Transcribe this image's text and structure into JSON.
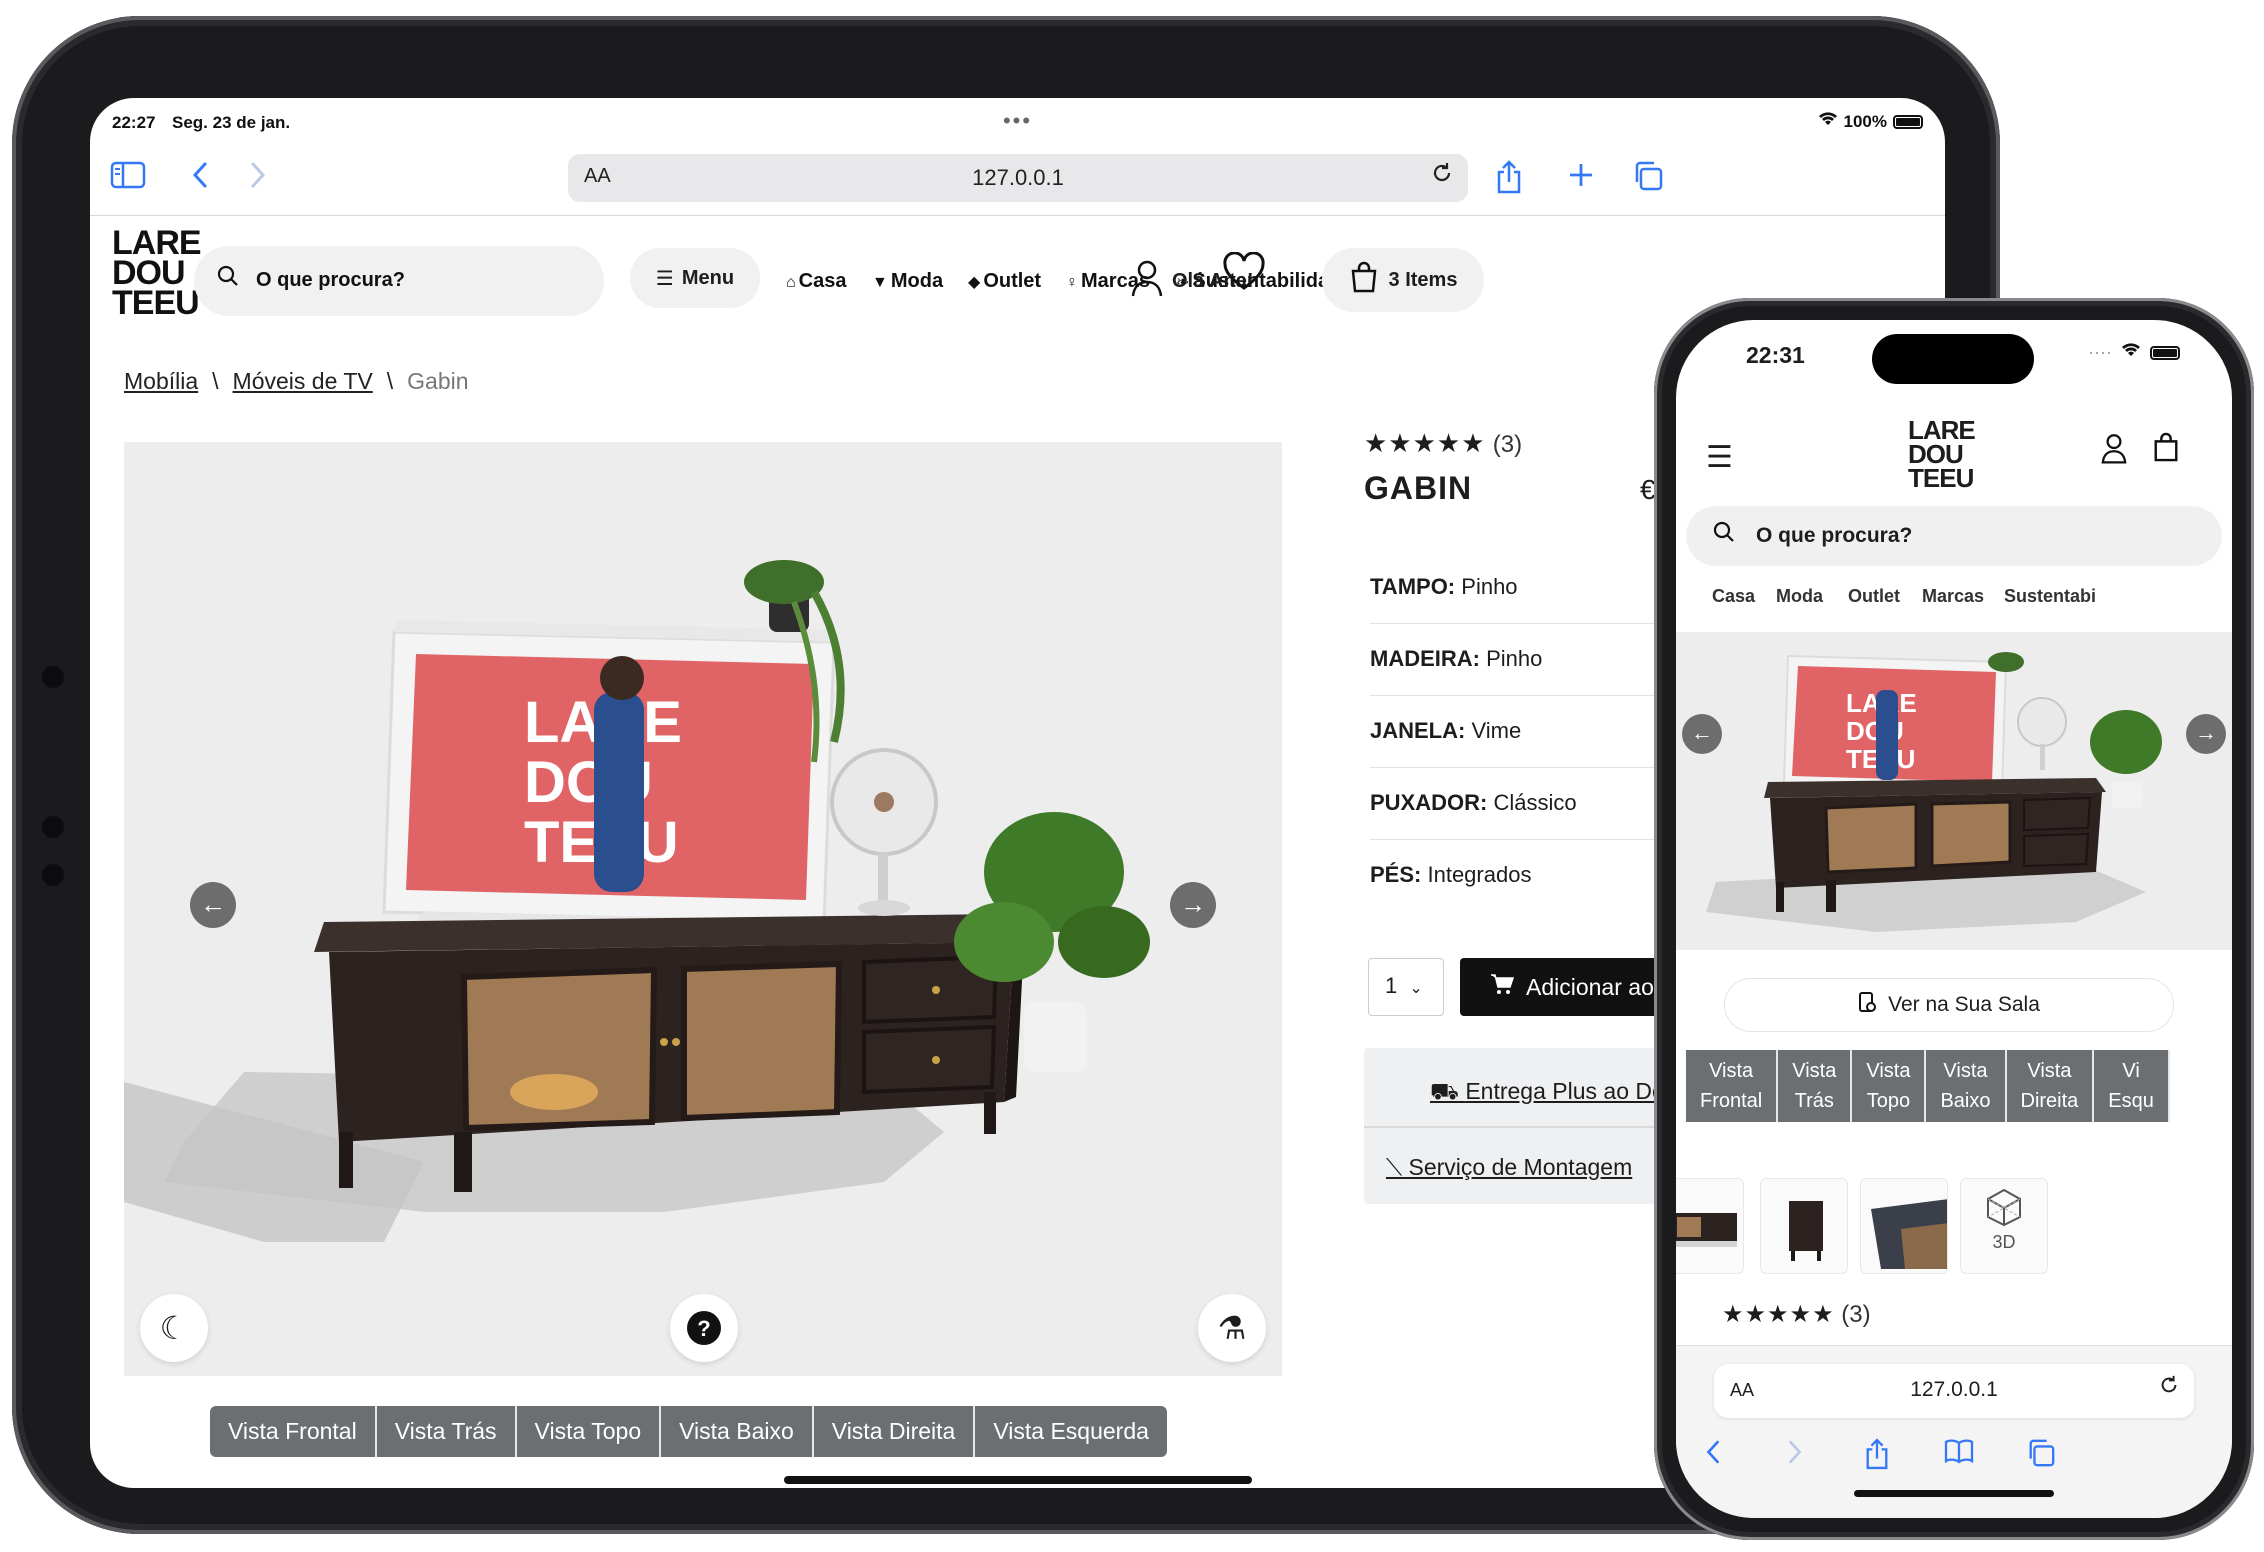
{
  "ipad": {
    "status": {
      "time": "22:27",
      "date": "Seg. 23 de jan.",
      "battery": "100%"
    },
    "browser": {
      "aa": "AA",
      "url": "127.0.0.1"
    },
    "site": {
      "logo_lines": [
        "LARE",
        "DOU",
        "TEEU"
      ],
      "search_placeholder": "O que procura?",
      "menu_label": "Menu",
      "nav": [
        "Casa",
        "Moda",
        "Outlet",
        "Marcas",
        "Sustentabilidade"
      ],
      "user_greeting": "Olá Ana!",
      "cart_label": "3 Items"
    },
    "breadcrumb": {
      "items": [
        "Mobília",
        "Móveis de TV"
      ],
      "current": "Gabin"
    },
    "product": {
      "rating_stars": "★★★★★",
      "rating_count": "(3)",
      "title": "GABIN",
      "price_prefix": "€",
      "attributes": [
        {
          "key": "TAMPO:",
          "value": "Pinho"
        },
        {
          "key": "MADEIRA:",
          "value": "Pinho"
        },
        {
          "key": "JANELA:",
          "value": "Vime"
        },
        {
          "key": "PUXADOR:",
          "value": "Clássico"
        },
        {
          "key": "PÉS:",
          "value": "Integrados"
        }
      ],
      "quantity": "1",
      "add_to_cart": "Adicionar ao",
      "delivery": "Entrega Plus ao Dom",
      "assembly": "Serviço de Montagem"
    },
    "view_tabs": [
      "Vista Frontal",
      "Vista Trás",
      "Vista Topo",
      "Vista Baixo",
      "Vista Direita",
      "Vista Esquerda"
    ]
  },
  "iphone": {
    "status": {
      "time": "22:31"
    },
    "site": {
      "logo_lines": [
        "LARE",
        "DOU",
        "TEEU"
      ],
      "search_placeholder": "O que procura?",
      "nav": [
        "Casa",
        "Moda",
        "Outlet",
        "Marcas",
        "Sustentabi"
      ]
    },
    "room_button": "Ver na Sua Sala",
    "view_tabs": [
      [
        "Vista",
        "Frontal"
      ],
      [
        "Vista",
        "Trás"
      ],
      [
        "Vista",
        "Topo"
      ],
      [
        "Vista",
        "Baixo"
      ],
      [
        "Vista",
        "Direita"
      ],
      [
        "Vi",
        "Esqu"
      ]
    ],
    "thumb_3d_label": "3D",
    "rating_stars": "★★★★★",
    "rating_count": "(3)",
    "browser": {
      "aa": "AA",
      "url": "127.0.0.1"
    }
  },
  "colors": {
    "accent": "#3478f6",
    "tab_bg": "#6c6f72",
    "tv_screen": "#e06466",
    "cabinet": "#2c2220",
    "rattan": "#a07a55"
  },
  "icons": [
    "sidebar-icon",
    "back-icon",
    "forward-icon",
    "reload-icon",
    "share-icon",
    "plus-icon",
    "tabs-icon",
    "search-icon",
    "hamburger-icon",
    "home-icon",
    "shirt-icon",
    "tag-icon",
    "bulb-icon",
    "leaf-icon",
    "user-icon",
    "heart-icon",
    "bag-icon",
    "arrow-left-icon",
    "arrow-right-icon",
    "moon-icon",
    "help-icon",
    "flask-icon",
    "cart-icon",
    "truck-icon",
    "tool-icon",
    "ar-icon",
    "book-icon",
    "wifi-icon",
    "battery-icon"
  ]
}
